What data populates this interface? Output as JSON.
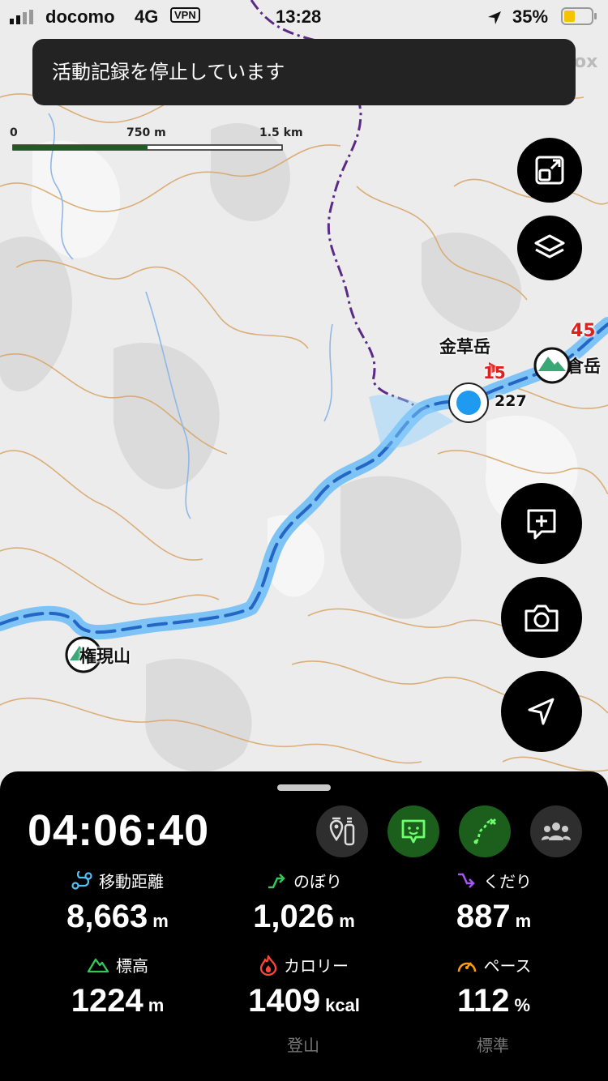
{
  "status_bar": {
    "carrier": "docomo",
    "network": "4G",
    "vpn": "VPN",
    "time": "13:28",
    "battery": "35%"
  },
  "toast": {
    "message": "活動記録を停止しています"
  },
  "scale": {
    "labels": [
      "0",
      "750 m",
      "1.5 km"
    ]
  },
  "map": {
    "peaks": [
      "金草岳",
      "白倉岳",
      "権現山"
    ],
    "altitude_marker": "227",
    "route_numbers": [
      "15",
      "45"
    ],
    "corner_text": "ox"
  },
  "map_buttons": [
    "expand-icon",
    "layers-icon",
    "add-note-icon",
    "camera-icon",
    "navigate-icon"
  ],
  "panel": {
    "elapsed": "04:06:40",
    "buttons": [
      "route-guide-icon",
      "message-icon",
      "course-icon",
      "group-icon"
    ],
    "stats": [
      {
        "label": "移動距離",
        "value": "8,663",
        "unit": "m",
        "icon": "distance-icon",
        "color": "#4fc3f7"
      },
      {
        "label": "のぼり",
        "value": "1,026",
        "unit": "m",
        "icon": "ascent-icon",
        "color": "#34c759"
      },
      {
        "label": "くだり",
        "value": "887",
        "unit": "m",
        "icon": "descent-icon",
        "color": "#a855f7"
      },
      {
        "label": "標高",
        "value": "1224",
        "unit": "m",
        "icon": "elevation-icon",
        "color": "#34c759"
      },
      {
        "label": "カロリー",
        "value": "1409",
        "unit": "kcal",
        "icon": "calorie-icon",
        "color": "#ff453a"
      },
      {
        "label": "ペース",
        "value": "112",
        "unit": "%",
        "icon": "pace-icon",
        "color": "#ff9f0a"
      }
    ],
    "activity_type": "登山",
    "pace_mode": "標準"
  }
}
